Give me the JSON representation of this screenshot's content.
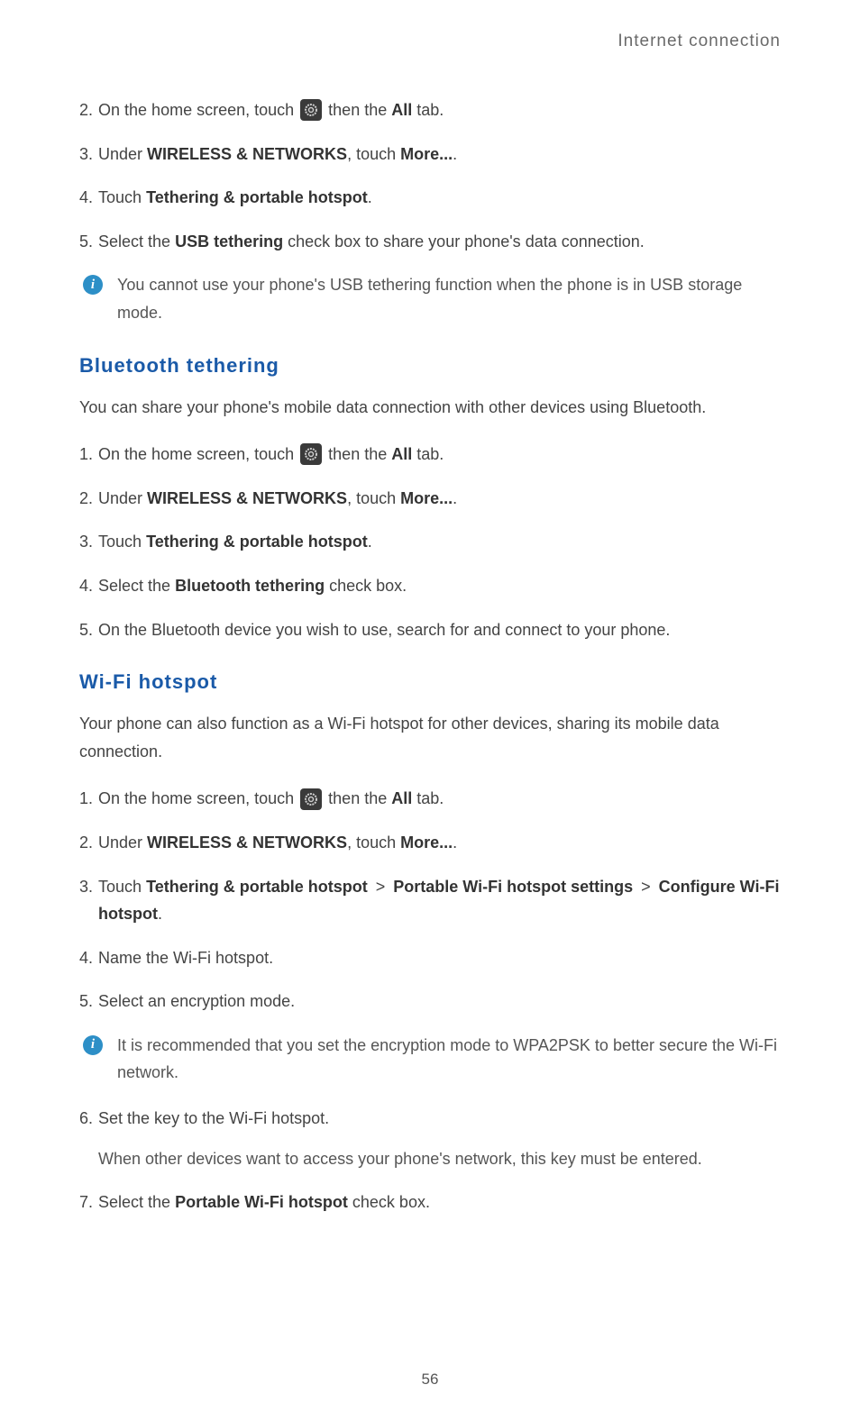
{
  "header": {
    "title": "Internet connection"
  },
  "usb": {
    "step2_pre": "On the home screen, touch ",
    "step2_post": " then the ",
    "step2_bold": "All",
    "step2_end": " tab.",
    "step3_pre": "Under ",
    "step3_bold": "WIRELESS & NETWORKS",
    "step3_mid": ", touch ",
    "step3_bold2": "More...",
    "step3_end": ".",
    "step4_pre": "Touch ",
    "step4_bold": "Tethering & portable hotspot",
    "step4_end": ".",
    "step5_pre": "Select the ",
    "step5_bold": "USB tethering",
    "step5_end": " check box to share your phone's data connection.",
    "info": "You cannot use your phone's USB tethering function when the phone is in USB storage mode."
  },
  "bt": {
    "heading": "Bluetooth  tethering",
    "intro": "You can share your phone's mobile data connection with other devices using Bluetooth.",
    "step1_pre": "On the home screen, touch ",
    "step1_post": " then the ",
    "step1_bold": "All",
    "step1_end": " tab.",
    "step2_pre": "Under ",
    "step2_bold": "WIRELESS & NETWORKS",
    "step2_mid": ", touch ",
    "step2_bold2": "More...",
    "step2_end": ".",
    "step3_pre": "Touch ",
    "step3_bold": "Tethering & portable hotspot",
    "step3_end": ".",
    "step4_pre": "Select the ",
    "step4_bold": "Bluetooth tethering",
    "step4_end": " check box.",
    "step5": "On the Bluetooth device you wish to use, search for and connect to your phone."
  },
  "wifi": {
    "heading": "Wi-Fi  hotspot",
    "intro": "Your phone can also function as a Wi-Fi hotspot for other devices, sharing its mobile data connection.",
    "step1_pre": "On the home screen, touch ",
    "step1_post": " then the ",
    "step1_bold": "All",
    "step1_end": " tab.",
    "step2_pre": "Under ",
    "step2_bold": "WIRELESS & NETWORKS",
    "step2_mid": ", touch ",
    "step2_bold2": "More...",
    "step2_end": ".",
    "step3_pre": "Touch ",
    "step3_bold1": "Tethering & portable hotspot",
    "step3_bold2": "Portable Wi-Fi hotspot settings",
    "step3_bold3": "Configure Wi-Fi hotspot",
    "step3_end": ".",
    "step4": "Name the Wi-Fi hotspot.",
    "step5": "Select an encryption mode.",
    "info": "It is recommended that you set the encryption mode to WPA2PSK to better secure the Wi-Fi network.",
    "step6": "Set the key to the Wi-Fi hotspot.",
    "step6_sub": "When other devices want to access your phone's network, this key must be entered.",
    "step7_pre": "Select the ",
    "step7_bold": "Portable Wi-Fi hotspot",
    "step7_end": " check box."
  },
  "nums": {
    "n1": "1.",
    "n2": "2.",
    "n3": "3.",
    "n4": "4.",
    "n5": "5.",
    "n6": "6.",
    "n7": "7."
  },
  "info_glyph": "i",
  "gt": ">",
  "page_number": "56"
}
